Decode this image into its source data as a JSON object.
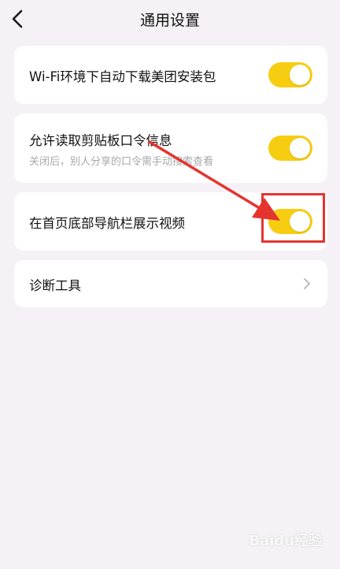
{
  "header": {
    "title": "通用设置",
    "back_icon": "chevron-left-icon"
  },
  "settings": {
    "wifi_download": {
      "label": "Wi-Fi环境下自动下载美团安装包",
      "enabled": true
    },
    "clipboard": {
      "label": "允许读取剪贴板口令信息",
      "description": "关闭后，别人分享的口令需手动搜索查看",
      "enabled": true
    },
    "nav_video": {
      "label": "在首页底部导航栏展示视频",
      "enabled": true
    },
    "diagnostics": {
      "label": "诊断工具",
      "icon": "chevron-right-icon"
    }
  },
  "colors": {
    "toggle_on": "#f7cd12",
    "annotation_red": "#e5342f",
    "background": "#f5f1f6"
  },
  "watermark": "Baidu经验"
}
